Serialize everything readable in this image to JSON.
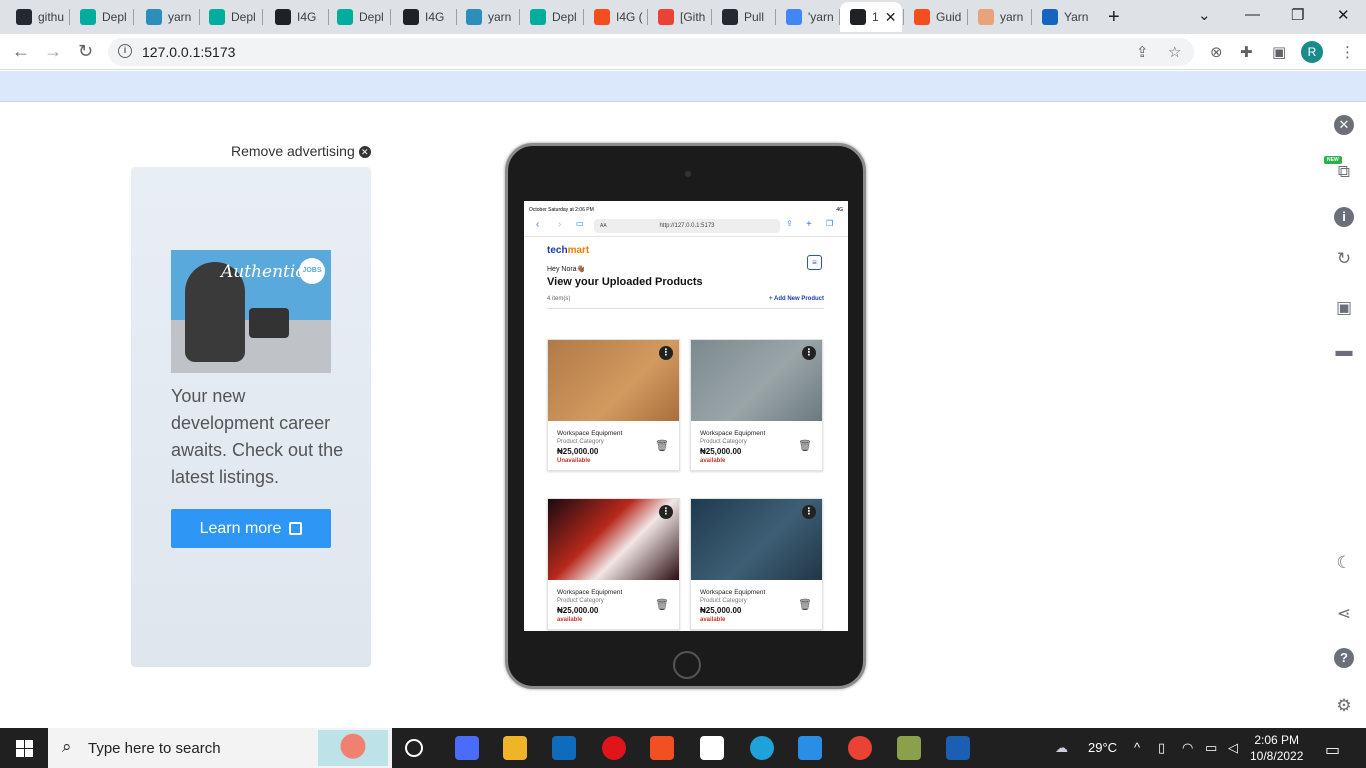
{
  "browser": {
    "tabs": [
      {
        "label": "githu",
        "favicon_color": "#24292f"
      },
      {
        "label": "Depl",
        "favicon_color": "#00ad9f"
      },
      {
        "label": "yarn",
        "favicon_color": "#2c8ebb"
      },
      {
        "label": "Depl",
        "favicon_color": "#00ad9f"
      },
      {
        "label": "I4G",
        "favicon_color": "#202124"
      },
      {
        "label": "Depl",
        "favicon_color": "#00ad9f"
      },
      {
        "label": "I4G",
        "favicon_color": "#202124"
      },
      {
        "label": "yarn",
        "favicon_color": "#2c8ebb"
      },
      {
        "label": "Depl",
        "favicon_color": "#00ad9f"
      },
      {
        "label": "I4G (",
        "favicon_color": "#f24e1e"
      },
      {
        "label": "[Gith",
        "favicon_color": "#ea4335"
      },
      {
        "label": "Pull",
        "favicon_color": "#24292f"
      },
      {
        "label": "'yarn",
        "favicon_color": "#4285f4"
      },
      {
        "label": "1",
        "favicon_color": "#202124"
      },
      {
        "label": "Guid",
        "favicon_color": "#f24e1e"
      },
      {
        "label": "yarn",
        "favicon_color": "#e8a27c"
      },
      {
        "label": "Yarn",
        "favicon_color": "#1565c0"
      }
    ],
    "active_tab_index": 13,
    "url": "127.0.0.1:5173",
    "profile_initial": "R"
  },
  "ad": {
    "remove_label": "Remove advertising",
    "image_brand": "Authentic",
    "image_badge": "JOBS",
    "text": "Your new development career awaits. Check out the latest listings.",
    "button_label": "Learn more"
  },
  "device": {
    "status_time": "October Saturday at 2:06 PM",
    "status_right": "4G",
    "safari_url": "http://127.0.0.1:5173",
    "safari_aa": "AA",
    "app": {
      "logo_tech": "tech",
      "logo_mart": "mart",
      "greeting": "Hey Nora👋🏾",
      "heading": "View your Uploaded Products",
      "item_count": "4 item(s)",
      "add_link": "+ Add New Product",
      "products": [
        {
          "name": "Workspace Equipment",
          "category": "Product Category",
          "price": "₦25,000.00",
          "status": "Unavailable"
        },
        {
          "name": "Workspace Equipment",
          "category": "Product Category",
          "price": "₦25,000.00",
          "status": "available"
        },
        {
          "name": "Workspace Equipment",
          "category": "Product Category",
          "price": "₦25,000.00",
          "status": "available"
        },
        {
          "name": "Workspace Equipment",
          "category": "Product Category",
          "price": "₦25,000.00",
          "status": "available"
        }
      ]
    }
  },
  "sidebar": {
    "new_badge": "NEW"
  },
  "taskbar": {
    "search_placeholder": "Type here to search",
    "weather": "29°C",
    "time": "2:06 PM",
    "date": "10/8/2022"
  }
}
